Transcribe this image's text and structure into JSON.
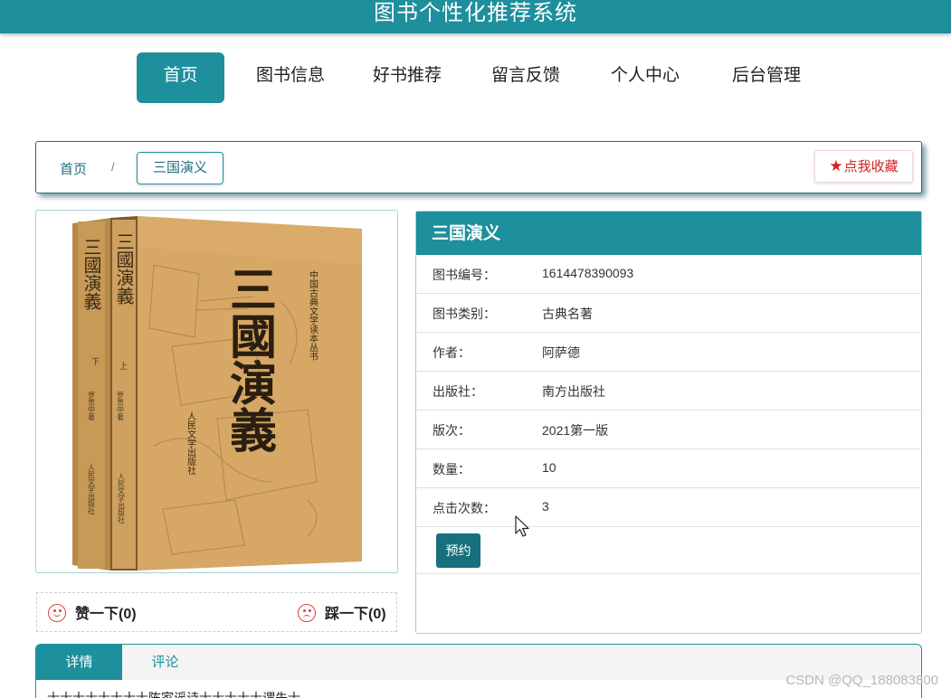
{
  "header": {
    "title": "图书个性化推荐系统"
  },
  "nav": {
    "items": [
      {
        "label": "首页",
        "active": true
      },
      {
        "label": "图书信息"
      },
      {
        "label": "好书推荐"
      },
      {
        "label": "留言反馈"
      },
      {
        "label": "个人中心"
      },
      {
        "label": "后台管理"
      }
    ]
  },
  "breadcrumb": {
    "home": "首页",
    "separator": "/",
    "current": "三国演义"
  },
  "favorite": {
    "label": "点我收藏",
    "icon": "star-icon",
    "color": "#d42020"
  },
  "cover": {
    "spine_left": "三國演義",
    "spine_right": "三國演義",
    "front_title": "三國演義",
    "series_text": "中国古典文学读本丛书",
    "publisher": "人民文学出版社",
    "vol_up": "上",
    "vol_down": "下",
    "author_vertical": "罗贯中著"
  },
  "votes": {
    "like": "赞一下(0)",
    "dislike": "踩一下(0)"
  },
  "book": {
    "title": "三国演义",
    "fields": [
      {
        "label": "图书编号：",
        "value": "1614478390093"
      },
      {
        "label": "图书类别：",
        "value": "古典名著"
      },
      {
        "label": "作者：",
        "value": "阿萨德"
      },
      {
        "label": "出版社：",
        "value": "南方出版社"
      },
      {
        "label": "版次：",
        "value": "2021第一版"
      },
      {
        "label": "数量：",
        "value": "10"
      },
      {
        "label": "点击次数：",
        "value": "3"
      }
    ],
    "reserve_label": "预约"
  },
  "tabs": {
    "details": "详情",
    "comments": "评论",
    "content": "士士士士士士士士陈家谣诗士士士士士谓朱士"
  },
  "watermark": "CSDN @QQ_188083800",
  "colors": {
    "primary": "#1e8f9c",
    "dark_primary": "#17707e",
    "danger": "#d42020"
  }
}
